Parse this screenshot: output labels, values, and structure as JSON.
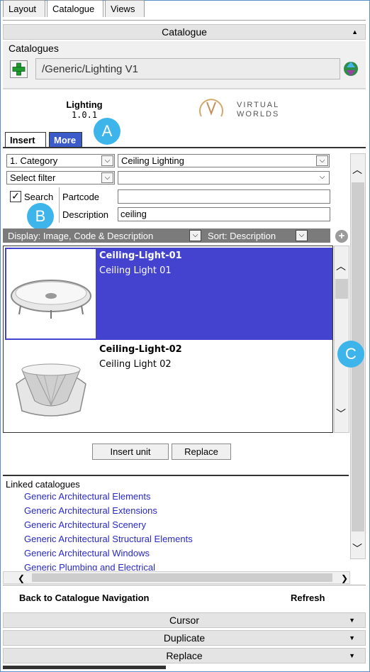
{
  "top_tabs": [
    {
      "label": "Layout"
    },
    {
      "label": "Catalogue"
    },
    {
      "label": "Views"
    }
  ],
  "catalogue_header": {
    "title": "Catalogue"
  },
  "catalogues": {
    "label": "Catalogues",
    "path": "/Generic/Lighting V1"
  },
  "catalogue_info": {
    "name": "Lighting",
    "version": "1.0.1",
    "logo_text_1": "VIRTUAL",
    "logo_text_2": "WORLDS"
  },
  "badges": {
    "a": "A",
    "b": "B",
    "c": "C"
  },
  "sub_tabs": {
    "insert": "Insert",
    "more": "More"
  },
  "filters": {
    "category_type": "1. Category",
    "category_value": "Ceiling Lighting",
    "select_filter": "Select filter",
    "select_filter_value": "",
    "search_label": "Search",
    "partcode_label": "Partcode",
    "partcode_value": "",
    "description_label": "Description",
    "description_value": "ceiling",
    "display_mode": "Display: Image, Code & Description",
    "sort_mode": "Sort: Description"
  },
  "items": [
    {
      "code": "Ceiling-Light-01",
      "description": "Ceiling Light 01",
      "selected": true
    },
    {
      "code": "Ceiling-Light-02",
      "description": "Ceiling Light 02",
      "selected": false
    }
  ],
  "actions": {
    "insert_unit": "Insert unit",
    "replace": "Replace"
  },
  "linked": {
    "title": "Linked catalogues",
    "items": [
      "Generic Architectural Elements",
      "Generic Architectural Extensions",
      "Generic Architectural Scenery",
      "Generic Architectural Structural Elements",
      "Generic Architectural Windows",
      "Generic Plumbing and Electrical"
    ]
  },
  "footer": {
    "back": "Back to Catalogue Navigation",
    "refresh": "Refresh"
  },
  "bottom_bars": {
    "cursor": "Cursor",
    "duplicate": "Duplicate",
    "replace": "Replace"
  },
  "colors": {
    "selected_row": "#4343cf",
    "link": "#2929c9",
    "badge": "#3eb5ea",
    "more_tab": "#3b5bc9"
  }
}
